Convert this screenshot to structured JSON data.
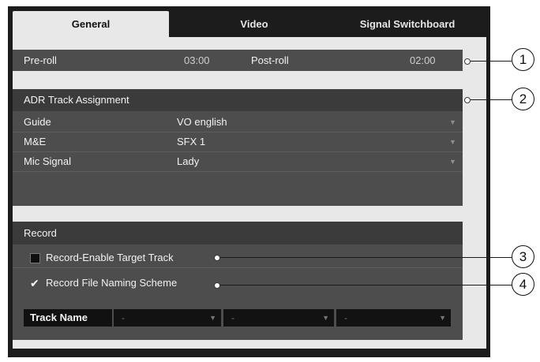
{
  "tabs": [
    {
      "label": "General",
      "active": true
    },
    {
      "label": "Video"
    },
    {
      "label": "Signal Switchboard"
    }
  ],
  "timing": {
    "preroll_label": "Pre-roll",
    "preroll_value": "03:00",
    "postroll_label": "Post-roll",
    "postroll_value": "02:00"
  },
  "adr": {
    "header": "ADR Track Assignment",
    "rows": [
      {
        "label": "Guide",
        "value": "VO english"
      },
      {
        "label": "M&E",
        "value": "SFX 1"
      },
      {
        "label": "Mic Signal",
        "value": "Lady"
      }
    ]
  },
  "record": {
    "header": "Record",
    "options": [
      {
        "label": "Record-Enable Target Track",
        "checked": false
      },
      {
        "label": "Record File Naming Scheme",
        "checked": true
      }
    ],
    "naming": {
      "label": "Track Name",
      "slots": [
        "-",
        "-",
        "-"
      ]
    }
  },
  "callouts": [
    "1",
    "2",
    "3",
    "4"
  ],
  "colors": {
    "panel_bg": "#e8e8e8",
    "section_bg": "#4d4d4d",
    "frame_bg": "#1c1c1c"
  }
}
